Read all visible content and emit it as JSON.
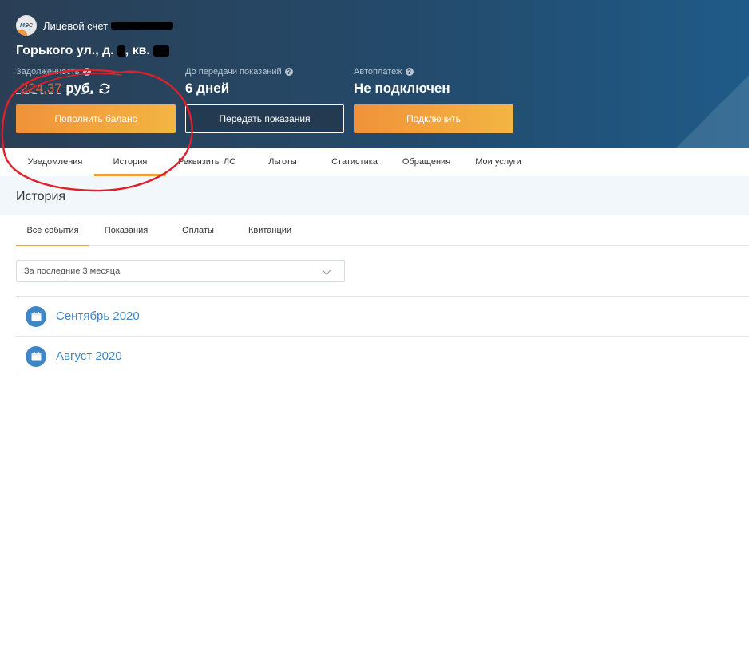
{
  "header": {
    "logo_text": "МЭС",
    "account_label": "Лицевой счет",
    "address_part1": "Горького ул., д.",
    "address_part2": ", кв.",
    "debt": {
      "label": "Задолженность",
      "amount": "-224,37",
      "unit": "руб."
    },
    "readings": {
      "label": "До передачи показаний",
      "value": "6 дней"
    },
    "autopay": {
      "label": "Автоплатеж",
      "value": "Не подключен"
    },
    "help_glyph": "?",
    "buttons": {
      "top_up": "Пополнить баланс",
      "submit_readings": "Передать показания",
      "connect": "Подключить"
    }
  },
  "tabs": [
    {
      "label": "Уведомления"
    },
    {
      "label": "История"
    },
    {
      "label": "Реквизиты ЛС"
    },
    {
      "label": "Льготы"
    },
    {
      "label": "Статистика"
    },
    {
      "label": "Обращения"
    },
    {
      "label": "Мои услуги"
    }
  ],
  "active_tab": "История",
  "section_title": "История",
  "subtabs": [
    {
      "label": "Все события"
    },
    {
      "label": "Показания"
    },
    {
      "label": "Оплаты"
    },
    {
      "label": "Квитанции"
    }
  ],
  "period_select": {
    "value": "За последние 3 месяца"
  },
  "months": [
    {
      "label": "Сентябрь 2020"
    },
    {
      "label": "Август 2020"
    }
  ],
  "colors": {
    "accent_orange": "#f0a33c",
    "debt_red": "#e85a3a",
    "link_blue": "#3f86c7",
    "header_bg": "#244a6b",
    "annotation_red": "#e0202a"
  }
}
